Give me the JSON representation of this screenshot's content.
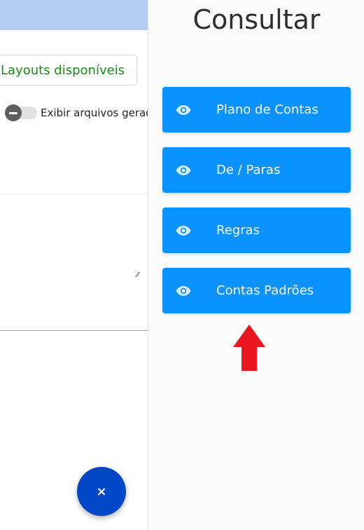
{
  "background": {
    "layouts_button_label": "Layouts disponíveis",
    "toggle_label": "Exibir arquivos gerad",
    "fab_label": "×"
  },
  "drawer": {
    "title": "Consultar",
    "items": [
      {
        "label": "Plano de Contas",
        "icon": "eye-icon"
      },
      {
        "label": "De / Paras",
        "icon": "eye-icon"
      },
      {
        "label": "Regras",
        "icon": "eye-icon"
      },
      {
        "label": "Contas Padrões",
        "icon": "eye-icon"
      }
    ]
  },
  "colors": {
    "menu_button": "#0a93ff",
    "fab": "#0047c8",
    "annotation_arrow": "#e8161e",
    "layouts_text": "#1a8a1a"
  }
}
